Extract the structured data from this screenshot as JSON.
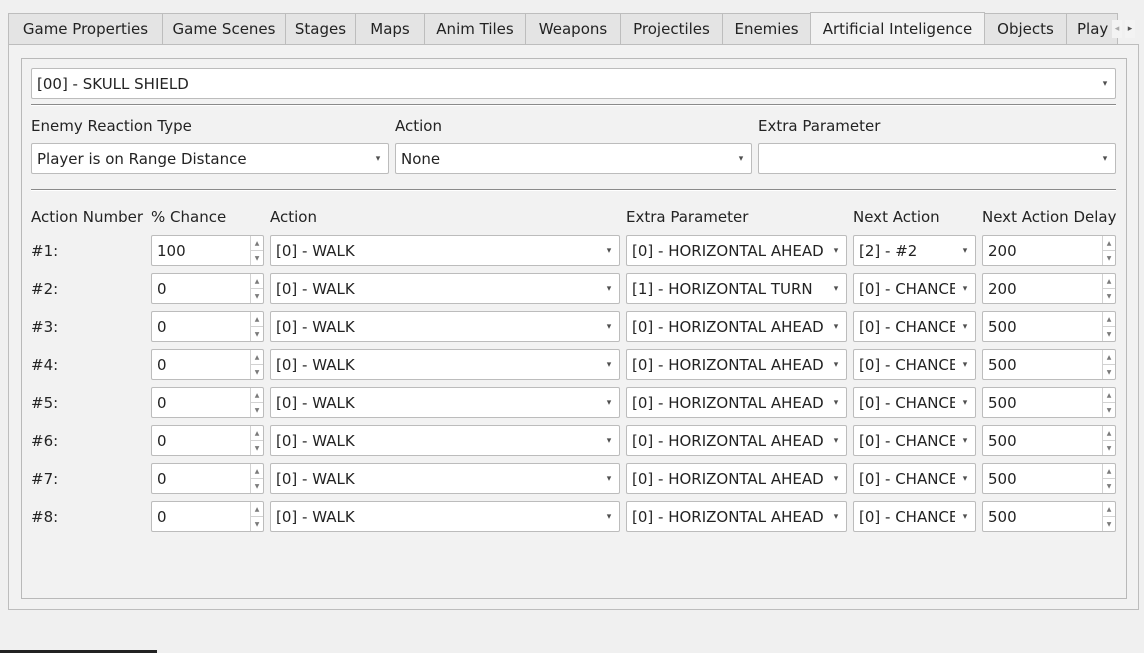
{
  "tabs": [
    {
      "label": "Game Properties",
      "active": false
    },
    {
      "label": "Game Scenes",
      "active": false
    },
    {
      "label": "Stages",
      "active": false
    },
    {
      "label": "Maps",
      "active": false
    },
    {
      "label": "Anim Tiles",
      "active": false
    },
    {
      "label": "Weapons",
      "active": false
    },
    {
      "label": "Projectiles",
      "active": false
    },
    {
      "label": "Enemies",
      "active": false
    },
    {
      "label": "Artificial Inteligence",
      "active": true
    },
    {
      "label": "Objects",
      "active": false
    },
    {
      "label": "Play",
      "active": false
    }
  ],
  "icons": {
    "tab_scroll_left": "◂",
    "tab_scroll_right": "▸",
    "combo_arrow": "▾",
    "spin_up": "▲",
    "spin_down": "▼"
  },
  "ai_selector": {
    "value": "[00] - SKULL SHIELD"
  },
  "reaction": {
    "type_label": "Enemy Reaction Type",
    "type_value": "Player is on Range Distance",
    "action_label": "Action",
    "action_value": "None",
    "extra_label": "Extra Parameter",
    "extra_value": ""
  },
  "columns": {
    "number": "Action Number",
    "chance": "% Chance",
    "action": "Action",
    "extra": "Extra Parameter",
    "next": "Next Action",
    "delay": "Next Action Delay"
  },
  "rows": [
    {
      "num": "#1:",
      "chance": "100",
      "action": "[0] - WALK",
      "extra": "[0] - HORIZONTAL AHEAD",
      "next": "[2] - #2",
      "delay": "200"
    },
    {
      "num": "#2:",
      "chance": "0",
      "action": "[0] - WALK",
      "extra": "[1] - HORIZONTAL TURN",
      "next": "[0] - CHANCE",
      "delay": "200"
    },
    {
      "num": "#3:",
      "chance": "0",
      "action": "[0] - WALK",
      "extra": "[0] - HORIZONTAL AHEAD",
      "next": "[0] - CHANCE",
      "delay": "500"
    },
    {
      "num": "#4:",
      "chance": "0",
      "action": "[0] - WALK",
      "extra": "[0] - HORIZONTAL AHEAD",
      "next": "[0] - CHANCE",
      "delay": "500"
    },
    {
      "num": "#5:",
      "chance": "0",
      "action": "[0] - WALK",
      "extra": "[0] - HORIZONTAL AHEAD",
      "next": "[0] - CHANCE",
      "delay": "500"
    },
    {
      "num": "#6:",
      "chance": "0",
      "action": "[0] - WALK",
      "extra": "[0] - HORIZONTAL AHEAD",
      "next": "[0] - CHANCE",
      "delay": "500"
    },
    {
      "num": "#7:",
      "chance": "0",
      "action": "[0] - WALK",
      "extra": "[0] - HORIZONTAL AHEAD",
      "next": "[0] - CHANCE",
      "delay": "500"
    },
    {
      "num": "#8:",
      "chance": "0",
      "action": "[0] - WALK",
      "extra": "[0] - HORIZONTAL AHEAD",
      "next": "[0] - CHANCE",
      "delay": "500"
    }
  ]
}
